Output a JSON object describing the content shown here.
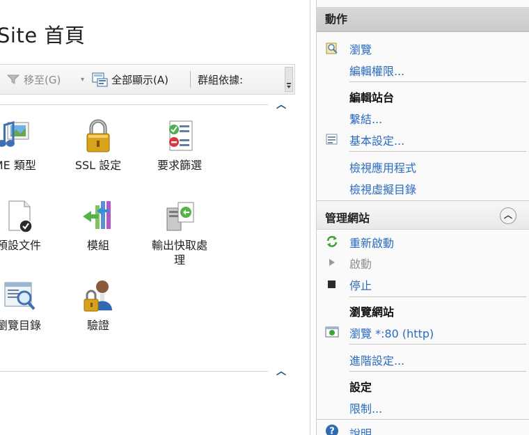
{
  "left": {
    "title": "Site 首頁",
    "toolbar": {
      "goto_label": "移至(G)",
      "show_all_label": "全部顯示(A)",
      "group_by_label": "群組依據:"
    },
    "features": [
      {
        "label": "IME 類型",
        "icon": "mime-types-icon"
      },
      {
        "label": "SSL 設定",
        "icon": "padlock-icon"
      },
      {
        "label": "要求篩選",
        "icon": "request-filter-icon"
      },
      {
        "label": "預設文件",
        "icon": "default-document-icon"
      },
      {
        "label": "模組",
        "icon": "modules-icon"
      },
      {
        "label": "輸出快取處\n理",
        "icon": "output-cache-icon"
      },
      {
        "label": "瀏覽目錄",
        "icon": "directory-browse-icon"
      },
      {
        "label": "驗證",
        "icon": "authentication-icon"
      }
    ]
  },
  "actions": {
    "header": "動作",
    "browse": "瀏覽",
    "edit_permissions": "編輯權限...",
    "edit_site_title": "編輯站台",
    "bindings": "繫結...",
    "basic_settings": "基本設定...",
    "view_applications": "檢視應用程式",
    "view_virtual_dirs": "檢視虛擬目錄",
    "manage_site_title": "管理網站",
    "restart": "重新啟動",
    "start": "啟動",
    "stop": "停止",
    "browse_site_title": "瀏覽網站",
    "browse_http": "瀏覽 *:80 (http)",
    "advanced_settings": "進階設定...",
    "config_title": "設定",
    "limits": "限制...",
    "help": "說明"
  },
  "colors": {
    "link": "#2a6bbf",
    "disabled": "#8f8f8f",
    "accent": "#1f4e86"
  }
}
